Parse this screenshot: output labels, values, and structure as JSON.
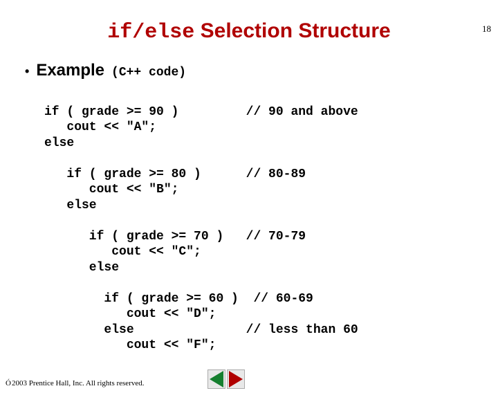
{
  "page_number": "18",
  "title": {
    "mono": "if/else",
    "rest": " Selection Structure"
  },
  "bullet": {
    "text": "Example",
    "sub": "(C++ code)"
  },
  "code": {
    "l1": "if ( grade >= 90 )         // 90 and above",
    "l2": "   cout << \"A\";",
    "l3": "else",
    "l4": "",
    "l5": "   if ( grade >= 80 )      // 80-89",
    "l6": "      cout << \"B\";",
    "l7": "   else",
    "l8": "",
    "l9": "      if ( grade >= 70 )   // 70-79",
    "l10": "         cout << \"C\";",
    "l11": "      else",
    "l12": "",
    "l13": "        if ( grade >= 60 )  // 60-69",
    "l14": "           cout << \"D\";",
    "l15": "        else               // less than 60",
    "l16": "           cout << \"F\";"
  },
  "footer": {
    "copyright": " 2003 Prentice Hall, Inc. All rights reserved.",
    "copy_symbol": "Ó"
  },
  "nav": {
    "prev": "previous-slide",
    "next": "next-slide"
  }
}
